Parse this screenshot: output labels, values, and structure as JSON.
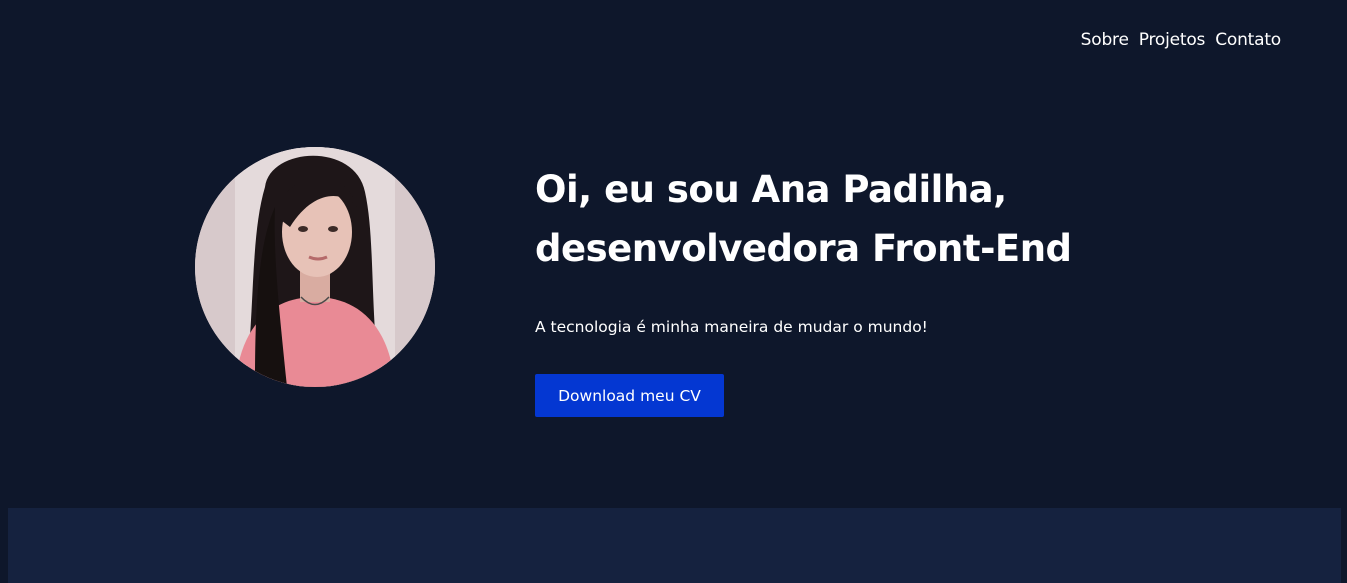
{
  "nav": {
    "items": [
      {
        "label": "Sobre"
      },
      {
        "label": "Projetos"
      },
      {
        "label": "Contato"
      }
    ]
  },
  "hero": {
    "headline_line1": "Oi, eu sou Ana Padilha,",
    "headline_line2": "desenvolvedora Front-End",
    "tagline": "A tecnologia é minha maneira de mudar o mundo!",
    "cv_button_label": "Download meu CV",
    "avatar_alt": "Ana Padilha"
  },
  "colors": {
    "background": "#0e172b",
    "section_background": "#15223f",
    "accent": "#0437d2",
    "text": "#ffffff"
  }
}
